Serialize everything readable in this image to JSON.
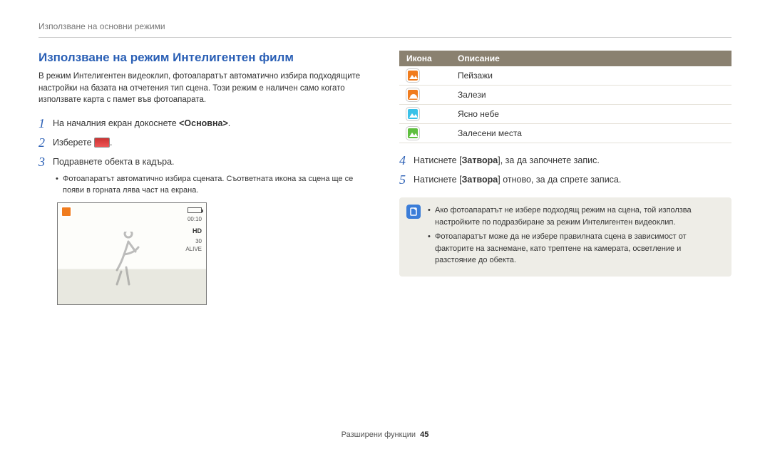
{
  "header": "Използване на основни режими",
  "section_title": "Използване на режим Интелигентен филм",
  "intro": "В режим Интелигентен видеоклип, фотоапаратът автоматично избира подходящите настройки на базата на отчетения тип сцена. Този режим е наличен само когато използвате карта с памет във фотоапарата.",
  "steps_left": [
    {
      "n": "1",
      "text_prefix": "На началния екран докоснете ",
      "bold": "<Основна>",
      "text_suffix": "."
    },
    {
      "n": "2",
      "text_prefix": "Изберете ",
      "bold": "",
      "text_suffix": "",
      "has_icon": true,
      "trailing": "."
    },
    {
      "n": "3",
      "text_prefix": "Подравнете обекта в кадъра.",
      "bold": "",
      "text_suffix": ""
    }
  ],
  "bullet_left": "Фотоапаратът автоматично избира сцената. Съответната икона за сцена ще се появи в горната лява част на екрана.",
  "camera_overlay": {
    "counter": "00:10",
    "hd": "HD",
    "side1": "30",
    "side2": "ALIVE",
    "rec": ""
  },
  "table_headers": {
    "icon": "Икона",
    "desc": "Описание"
  },
  "table_rows": [
    {
      "icon_class": "landscape",
      "label": "Пейзажи"
    },
    {
      "icon_class": "sunset",
      "label": "Залези"
    },
    {
      "icon_class": "sky",
      "label": "Ясно небе"
    },
    {
      "icon_class": "forest",
      "label": "Залесени места"
    }
  ],
  "steps_right": [
    {
      "n": "4",
      "text_prefix": "Натиснете [",
      "bold": "Затвора",
      "text_suffix": "], за да започнете запис."
    },
    {
      "n": "5",
      "text_prefix": "Натиснете [",
      "bold": "Затвора",
      "text_suffix": "] отново, за да спрете записа."
    }
  ],
  "notes": [
    "Ако фотоапаратът не избере подходящ режим на сцена, той използва настройките по подразбиране за режим Интелигентен видеоклип.",
    "Фотоапаратът може да не избере правилната сцена в зависимост от факторите на заснемане, като трептене на камерата, осветление и разстояние до обекта."
  ],
  "footer": {
    "label": "Разширени функции",
    "page": "45"
  }
}
